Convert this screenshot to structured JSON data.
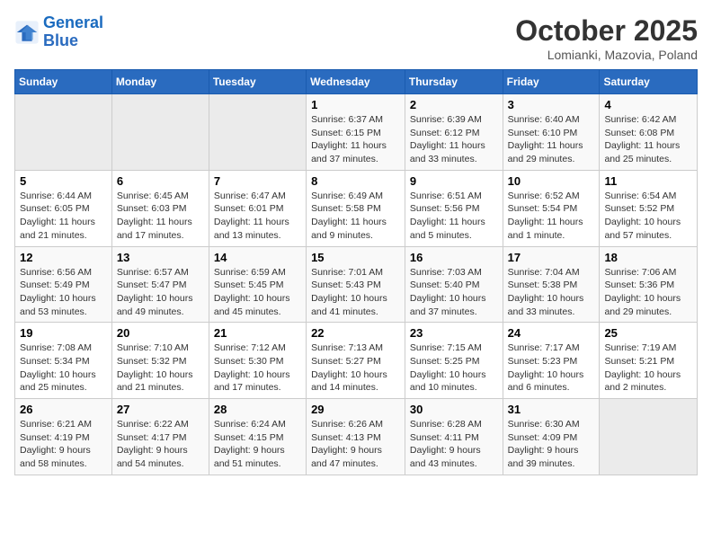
{
  "logo": {
    "line1": "General",
    "line2": "Blue"
  },
  "title": "October 2025",
  "subtitle": "Lomianki, Mazovia, Poland",
  "weekdays": [
    "Sunday",
    "Monday",
    "Tuesday",
    "Wednesday",
    "Thursday",
    "Friday",
    "Saturday"
  ],
  "weeks": [
    [
      {
        "day": "",
        "info": ""
      },
      {
        "day": "",
        "info": ""
      },
      {
        "day": "",
        "info": ""
      },
      {
        "day": "1",
        "info": "Sunrise: 6:37 AM\nSunset: 6:15 PM\nDaylight: 11 hours\nand 37 minutes."
      },
      {
        "day": "2",
        "info": "Sunrise: 6:39 AM\nSunset: 6:12 PM\nDaylight: 11 hours\nand 33 minutes."
      },
      {
        "day": "3",
        "info": "Sunrise: 6:40 AM\nSunset: 6:10 PM\nDaylight: 11 hours\nand 29 minutes."
      },
      {
        "day": "4",
        "info": "Sunrise: 6:42 AM\nSunset: 6:08 PM\nDaylight: 11 hours\nand 25 minutes."
      }
    ],
    [
      {
        "day": "5",
        "info": "Sunrise: 6:44 AM\nSunset: 6:05 PM\nDaylight: 11 hours\nand 21 minutes."
      },
      {
        "day": "6",
        "info": "Sunrise: 6:45 AM\nSunset: 6:03 PM\nDaylight: 11 hours\nand 17 minutes."
      },
      {
        "day": "7",
        "info": "Sunrise: 6:47 AM\nSunset: 6:01 PM\nDaylight: 11 hours\nand 13 minutes."
      },
      {
        "day": "8",
        "info": "Sunrise: 6:49 AM\nSunset: 5:58 PM\nDaylight: 11 hours\nand 9 minutes."
      },
      {
        "day": "9",
        "info": "Sunrise: 6:51 AM\nSunset: 5:56 PM\nDaylight: 11 hours\nand 5 minutes."
      },
      {
        "day": "10",
        "info": "Sunrise: 6:52 AM\nSunset: 5:54 PM\nDaylight: 11 hours\nand 1 minute."
      },
      {
        "day": "11",
        "info": "Sunrise: 6:54 AM\nSunset: 5:52 PM\nDaylight: 10 hours\nand 57 minutes."
      }
    ],
    [
      {
        "day": "12",
        "info": "Sunrise: 6:56 AM\nSunset: 5:49 PM\nDaylight: 10 hours\nand 53 minutes."
      },
      {
        "day": "13",
        "info": "Sunrise: 6:57 AM\nSunset: 5:47 PM\nDaylight: 10 hours\nand 49 minutes."
      },
      {
        "day": "14",
        "info": "Sunrise: 6:59 AM\nSunset: 5:45 PM\nDaylight: 10 hours\nand 45 minutes."
      },
      {
        "day": "15",
        "info": "Sunrise: 7:01 AM\nSunset: 5:43 PM\nDaylight: 10 hours\nand 41 minutes."
      },
      {
        "day": "16",
        "info": "Sunrise: 7:03 AM\nSunset: 5:40 PM\nDaylight: 10 hours\nand 37 minutes."
      },
      {
        "day": "17",
        "info": "Sunrise: 7:04 AM\nSunset: 5:38 PM\nDaylight: 10 hours\nand 33 minutes."
      },
      {
        "day": "18",
        "info": "Sunrise: 7:06 AM\nSunset: 5:36 PM\nDaylight: 10 hours\nand 29 minutes."
      }
    ],
    [
      {
        "day": "19",
        "info": "Sunrise: 7:08 AM\nSunset: 5:34 PM\nDaylight: 10 hours\nand 25 minutes."
      },
      {
        "day": "20",
        "info": "Sunrise: 7:10 AM\nSunset: 5:32 PM\nDaylight: 10 hours\nand 21 minutes."
      },
      {
        "day": "21",
        "info": "Sunrise: 7:12 AM\nSunset: 5:30 PM\nDaylight: 10 hours\nand 17 minutes."
      },
      {
        "day": "22",
        "info": "Sunrise: 7:13 AM\nSunset: 5:27 PM\nDaylight: 10 hours\nand 14 minutes."
      },
      {
        "day": "23",
        "info": "Sunrise: 7:15 AM\nSunset: 5:25 PM\nDaylight: 10 hours\nand 10 minutes."
      },
      {
        "day": "24",
        "info": "Sunrise: 7:17 AM\nSunset: 5:23 PM\nDaylight: 10 hours\nand 6 minutes."
      },
      {
        "day": "25",
        "info": "Sunrise: 7:19 AM\nSunset: 5:21 PM\nDaylight: 10 hours\nand 2 minutes."
      }
    ],
    [
      {
        "day": "26",
        "info": "Sunrise: 6:21 AM\nSunset: 4:19 PM\nDaylight: 9 hours\nand 58 minutes."
      },
      {
        "day": "27",
        "info": "Sunrise: 6:22 AM\nSunset: 4:17 PM\nDaylight: 9 hours\nand 54 minutes."
      },
      {
        "day": "28",
        "info": "Sunrise: 6:24 AM\nSunset: 4:15 PM\nDaylight: 9 hours\nand 51 minutes."
      },
      {
        "day": "29",
        "info": "Sunrise: 6:26 AM\nSunset: 4:13 PM\nDaylight: 9 hours\nand 47 minutes."
      },
      {
        "day": "30",
        "info": "Sunrise: 6:28 AM\nSunset: 4:11 PM\nDaylight: 9 hours\nand 43 minutes."
      },
      {
        "day": "31",
        "info": "Sunrise: 6:30 AM\nSunset: 4:09 PM\nDaylight: 9 hours\nand 39 minutes."
      },
      {
        "day": "",
        "info": ""
      }
    ]
  ]
}
